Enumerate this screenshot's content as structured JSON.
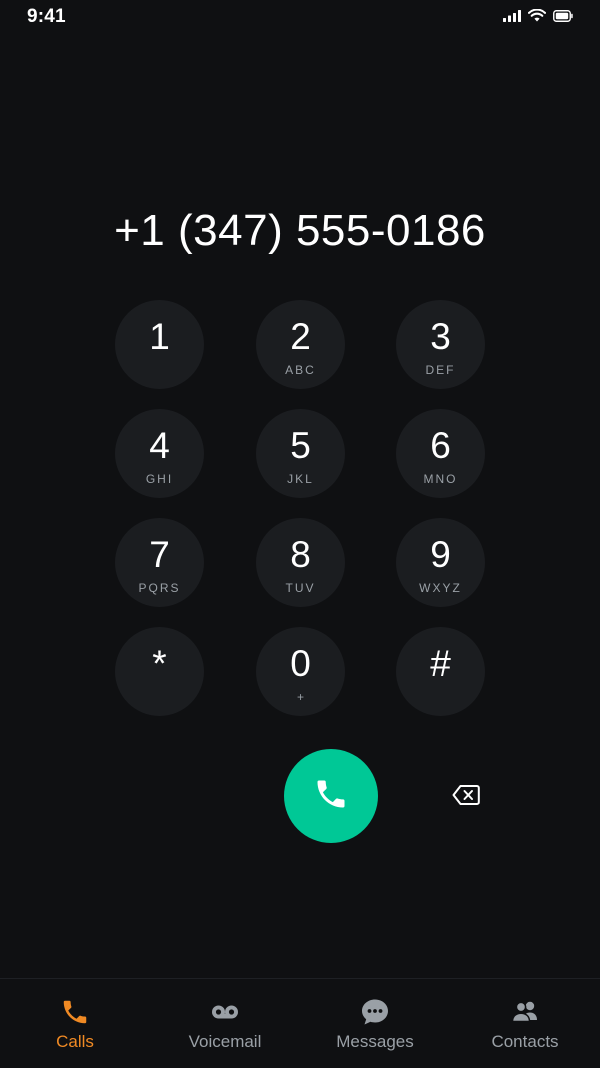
{
  "status_bar": {
    "time": "9:41",
    "icons": [
      "signal-icon",
      "wifi-icon",
      "battery-icon"
    ]
  },
  "dialer": {
    "number": "+1 (347) 555-0186"
  },
  "keypad": {
    "keys": [
      {
        "digit": "1",
        "letters": ""
      },
      {
        "digit": "2",
        "letters": "ABC"
      },
      {
        "digit": "3",
        "letters": "DEF"
      },
      {
        "digit": "4",
        "letters": "GHI"
      },
      {
        "digit": "5",
        "letters": "JKL"
      },
      {
        "digit": "6",
        "letters": "MNO"
      },
      {
        "digit": "7",
        "letters": "PQRS"
      },
      {
        "digit": "8",
        "letters": "TUV"
      },
      {
        "digit": "9",
        "letters": "WXYZ"
      },
      {
        "digit": "*",
        "letters": ""
      },
      {
        "digit": "0",
        "letters": "+"
      },
      {
        "digit": "#",
        "letters": ""
      }
    ]
  },
  "actions": {
    "call_icon": "phone-icon",
    "backspace_icon": "backspace-icon"
  },
  "tabs": [
    {
      "label": "Calls",
      "icon": "phone-icon",
      "active": true
    },
    {
      "label": "Voicemail",
      "icon": "voicemail-icon",
      "active": false
    },
    {
      "label": "Messages",
      "icon": "chat-bubble-icon",
      "active": false
    },
    {
      "label": "Contacts",
      "icon": "people-icon",
      "active": false
    }
  ],
  "colors": {
    "background": "#0f1012",
    "key_background": "#1b1d20",
    "call_green": "#00c896",
    "active_tab": "#f08a24",
    "inactive": "#9aa0a6"
  }
}
